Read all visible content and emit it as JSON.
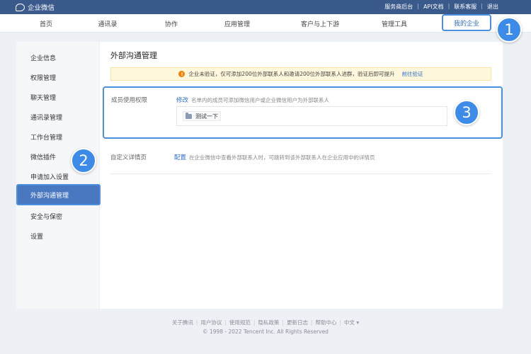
{
  "app": {
    "title": "企业微信"
  },
  "top_links": [
    "服务商后台",
    "API文档",
    "联系客服",
    "退出"
  ],
  "nav": {
    "items": [
      "首页",
      "通讯录",
      "协作",
      "应用管理",
      "客户与上下游",
      "管理工具"
    ],
    "active": "我的企业"
  },
  "sidebar": {
    "items_before": [
      "企业信息",
      "权限管理",
      "聊天管理",
      "通讯录管理",
      "工作台管理",
      "微信插件",
      "申请加入设置"
    ],
    "active": "外部沟通管理",
    "items_after": [
      "安全与保密",
      "设置"
    ]
  },
  "main": {
    "title": "外部沟通管理",
    "notice": {
      "icon": "warning-icon",
      "text": "企业未验证，仅可添加200位外部联系人和邀请200位外部联系人进群，验证后即可提升",
      "link": "前往验证"
    },
    "member_permission": {
      "label": "成员使用权限",
      "edit_link": "修改",
      "description": "名单内的成员可添加微信用户或企业微信用户为外部联系人",
      "member_tag": "测试一下"
    },
    "detail_page": {
      "label": "自定义详情页",
      "config_link": "配置",
      "description": "在企业微信中查看外部联系人时，可跳转到该外部联系人在企业应用中的详情页"
    }
  },
  "footer": {
    "links": [
      "关于腾讯",
      "用户协议",
      "使用规范",
      "隐私政策",
      "更新日志",
      "帮助中心",
      "中文 ▾"
    ],
    "copyright": "© 1998 - 2022 Tencent Inc. All Rights Reserved"
  },
  "annotations": [
    "1",
    "2",
    "3"
  ],
  "colors": {
    "topbar": "#3a5a8c",
    "accent": "#4a8fe0",
    "sidebar_active": "#4a78c0",
    "link": "#2f6fc8"
  }
}
